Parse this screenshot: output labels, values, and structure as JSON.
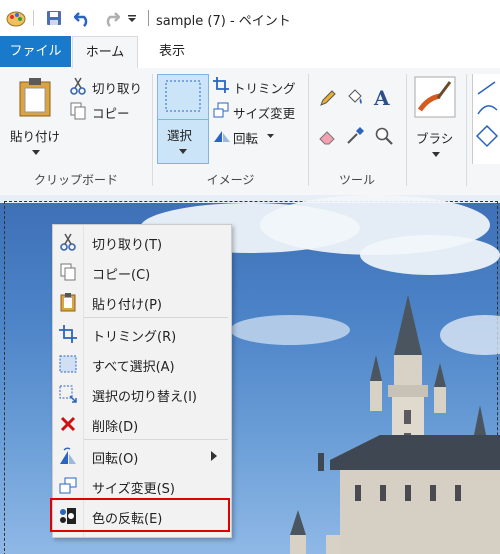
{
  "window": {
    "title": "sample (7) - ペイント"
  },
  "tabs": [
    {
      "label": "ファイル"
    },
    {
      "label": "ホーム"
    },
    {
      "label": "表示"
    }
  ],
  "ribbon": {
    "clipboard": {
      "paste": "貼り付け",
      "cut": "切り取り",
      "copy": "コピー",
      "group": "クリップボード"
    },
    "image": {
      "select": "選択",
      "crop": "トリミング",
      "resize": "サイズ変更",
      "rotate": "回転",
      "group": "イメージ"
    },
    "tools": {
      "group": "ツール",
      "text": "A"
    },
    "brushes": {
      "label": "ブラシ"
    }
  },
  "context_menu": {
    "items": [
      {
        "label": "切り取り(T)",
        "icon": "scissors-icon"
      },
      {
        "label": "コピー(C)",
        "icon": "copy-icon"
      },
      {
        "label": "貼り付け(P)",
        "icon": "paste-icon"
      },
      {
        "label": "トリミング(R)",
        "icon": "crop-icon"
      },
      {
        "label": "すべて選択(A)",
        "icon": "select-all-icon"
      },
      {
        "label": "選択の切り替え(I)",
        "icon": "invert-selection-icon"
      },
      {
        "label": "削除(D)",
        "icon": "delete-icon"
      },
      {
        "label": "回転(O)",
        "icon": "rotate-icon"
      },
      {
        "label": "サイズ変更(S)",
        "icon": "resize-icon"
      },
      {
        "label": "色の反転(E)",
        "icon": "invert-color-icon"
      }
    ]
  },
  "colors": {
    "accent": "#1979ca",
    "highlight": "#e00000",
    "menu_bg": "#f2f2f2"
  }
}
